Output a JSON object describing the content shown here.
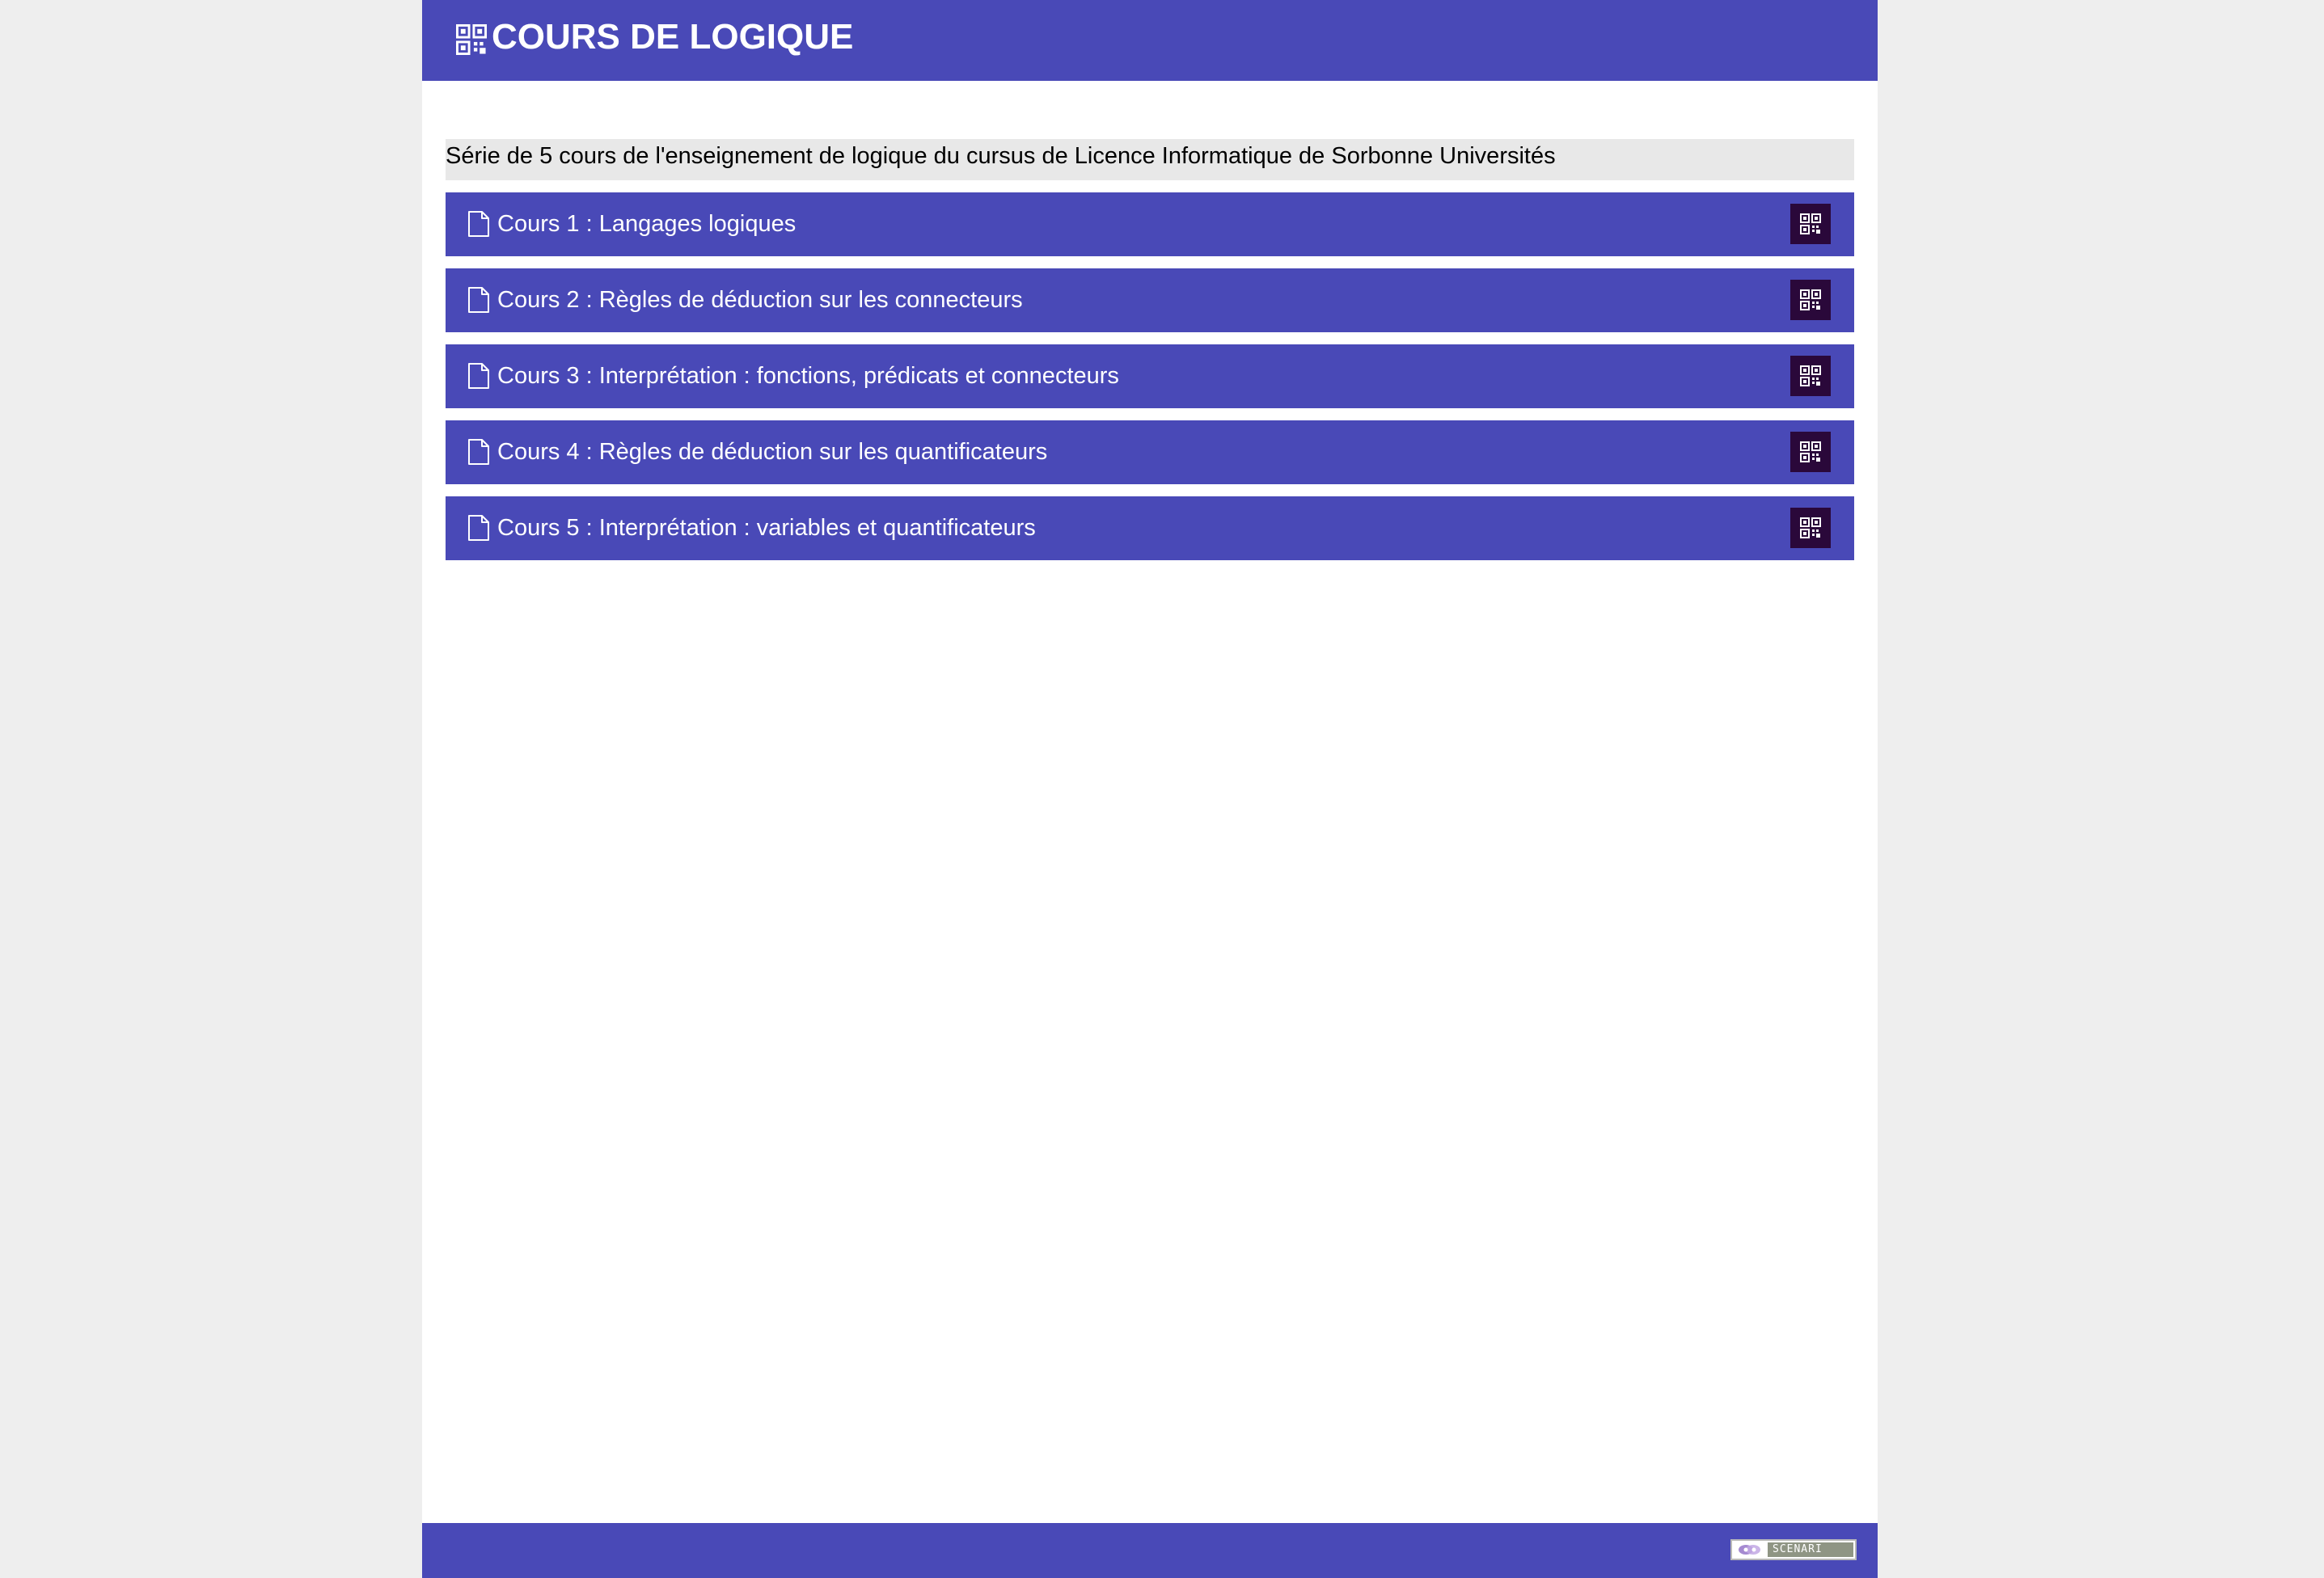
{
  "header": {
    "title": "COURS DE LOGIQUE"
  },
  "description": "Série de 5 cours de l'enseignement de logique du cursus de Licence Informatique de Sorbonne Universités",
  "courses": [
    {
      "label": "Cours 1 : Langages logiques"
    },
    {
      "label": "Cours 2 : Règles de déduction sur les connecteurs"
    },
    {
      "label": "Cours 3 : Interprétation : fonctions, prédicats et connecteurs"
    },
    {
      "label": "Cours 4 : Règles de déduction sur les quantificateurs"
    },
    {
      "label": "Cours 5 : Interprétation : variables et quantificateurs"
    }
  ],
  "footer": {
    "badge_text": "SCENARI"
  },
  "colors": {
    "accent": "#4949b7",
    "qr_button": "#2a083a",
    "page_background": "#eeeeee",
    "description_background": "#e8e8e8"
  },
  "icons": {
    "header": "qr-code-icon",
    "course": "document-icon",
    "course_action": "qr-code-icon"
  }
}
